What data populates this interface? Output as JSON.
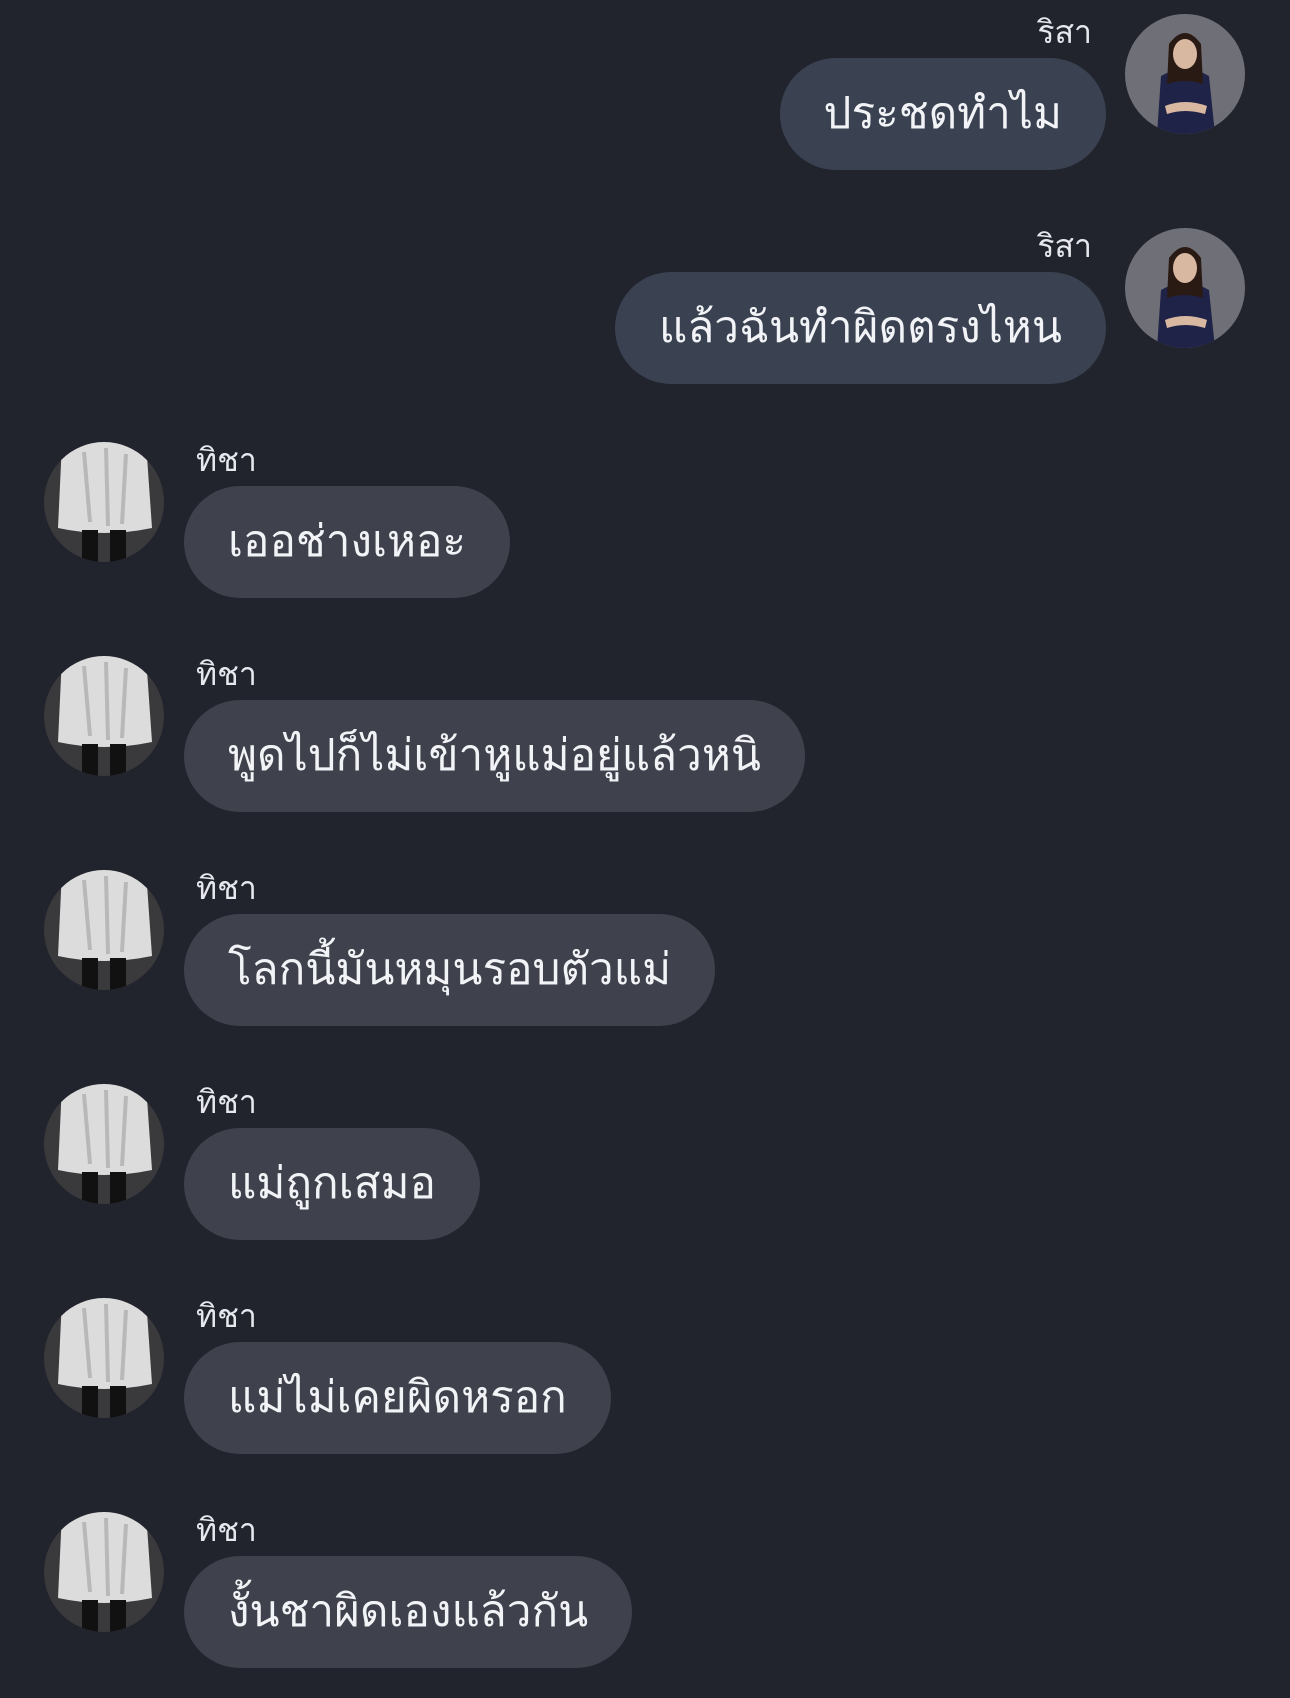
{
  "messages": [
    {
      "sender": "ริสา",
      "text": "ประชดทำไม",
      "side": "out"
    },
    {
      "sender": "ริสา",
      "text": "แล้วฉันทำผิดตรงไหน",
      "side": "out"
    },
    {
      "sender": "ทิชา",
      "text": "เออช่างเหอะ",
      "side": "in"
    },
    {
      "sender": "ทิชา",
      "text": "พูดไปก็ไม่เข้าหูแม่อยู่แล้วหนิ",
      "side": "in"
    },
    {
      "sender": "ทิชา",
      "text": "โลกนี้มันหมุนรอบตัวแม่",
      "side": "in"
    },
    {
      "sender": "ทิชา",
      "text": "แม่ถูกเสมอ",
      "side": "in"
    },
    {
      "sender": "ทิชา",
      "text": "แม่ไม่เคยผิดหรอก",
      "side": "in"
    },
    {
      "sender": "ทิชา",
      "text": "งั้นชาผิดเองแล้วกัน",
      "side": "in"
    }
  ],
  "colors": {
    "background": "#22242d",
    "outgoing_bubble": "#3a4252",
    "incoming_bubble": "#3f424c",
    "text": "#f2f3f6"
  }
}
